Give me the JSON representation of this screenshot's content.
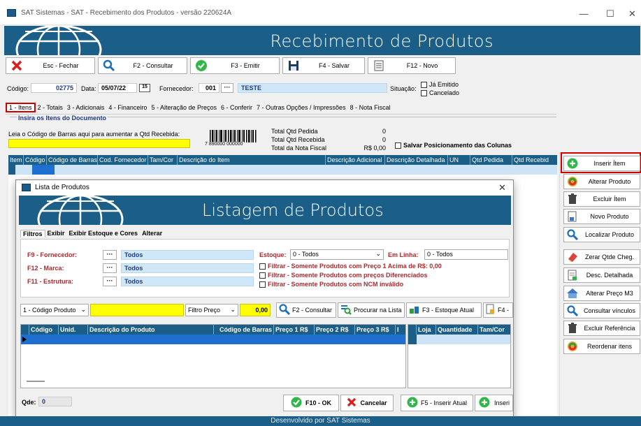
{
  "window": {
    "title": "SAT Sistemas - SAT - Recebimento dos Produtos - versão 220624A",
    "minimize": "—",
    "maximize": "☐",
    "close": "✕"
  },
  "banner": {
    "title": "Recebimento de Produtos"
  },
  "toolbar": [
    {
      "label": "Esc - Fechar",
      "icon": "close-icon"
    },
    {
      "label": "F2 - Consultar",
      "icon": "search-icon"
    },
    {
      "label": "F3 - Emitir",
      "icon": "check-icon"
    },
    {
      "label": "F4 - Salvar",
      "icon": "save-icon"
    },
    {
      "label": "F12 - Novo",
      "icon": "document-icon"
    }
  ],
  "header": {
    "codigo_label": "Código:",
    "codigo": "02775",
    "data_label": "Data:",
    "data": "05/07/22",
    "calendar": "15",
    "fornecedor_label": "Fornecedor:",
    "fornecedor_code": "001",
    "fornecedor_dots": "···",
    "fornecedor_name": "TESTE",
    "situacao_label": "Situação:",
    "ja_emitido": "Já Emitido",
    "cancelado": "Cancelado"
  },
  "tabs": [
    "1 - Itens",
    "2 - Totais",
    "3 - Adicionais",
    "4 - Financeiro",
    "5 - Alteração de Preços",
    "6 - Conferir",
    "7 - Outras Opções / Impressões",
    "8 - Nota Fiscal"
  ],
  "items": {
    "section_title": "Insira os Itens do Documento",
    "barcode_prompt": "Leia o Código de Barras aqui para aumentar a Qtd Recebida:",
    "barcode_number": "7 890000 000000",
    "totals": [
      {
        "label": "Total Qtd Pedida",
        "value": "0"
      },
      {
        "label": "Total Qtd Recebida",
        "value": "0"
      },
      {
        "label": "Total da Nota Fiscal",
        "value": "R$ 0,00"
      }
    ],
    "save_columns": "Salvar Posicionamento das Colunas",
    "columns": [
      "Item",
      "Código",
      "Código de Barras",
      "Cod. Fornecedor",
      "Tam/Cor",
      "Descrição do Item",
      "Descrição Adicional",
      "Descrição Detalhada",
      "UN",
      "Qtd Pedida",
      "Qtd Recebid"
    ]
  },
  "side_buttons": [
    {
      "label": "Inserir Ítem",
      "icon": "plus-circle-icon"
    },
    {
      "label": "Alterar Produto",
      "icon": "recycle-icon"
    },
    {
      "label": "Excluir Ítem",
      "icon": "trash-icon"
    },
    {
      "label": "Novo Produto",
      "icon": "new-product-icon"
    },
    {
      "label": "Localizar Produto",
      "icon": "search-icon"
    },
    {
      "label": "Zerar Qtde Cheg.",
      "icon": "eraser-icon"
    },
    {
      "label": "Desc. Detalhada",
      "icon": "document-edit-icon"
    },
    {
      "label": "Alterar Preço M3",
      "icon": "house-icon"
    },
    {
      "label": "Consultar vínculos",
      "icon": "search-icon"
    },
    {
      "label": "Excluir Referência",
      "icon": "trash-icon"
    },
    {
      "label": "Reordenar itens",
      "icon": "recycle-icon"
    }
  ],
  "modal": {
    "title": "Lista de Produtos",
    "close": "✕",
    "banner_title": "Listagem de Produtos",
    "tabs": [
      "Filtros",
      "Exibir",
      "Exibir Estoque e Cores",
      "Alterar"
    ],
    "filters": [
      {
        "label": "F9 - Fornecedor:",
        "value": "Todos"
      },
      {
        "label": "F12 - Marca:",
        "value": "Todos"
      },
      {
        "label": "F11 - Estrutura:",
        "value": "Todos"
      }
    ],
    "dots": "···",
    "estoque_label": "Estoque:",
    "estoque_value": "0 - Todos",
    "em_linha_label": "Em Linha:",
    "em_linha_value": "0 - Todos",
    "checks": [
      "Filtrar - Somente Produtos com Preço 1 Acima de R$: 0,00",
      "Filtrar - Somente Produtos com preços Diferenciados",
      "Filtrar - Somente Produtos com NCM inválido"
    ],
    "search_type": "1 - Código Produto",
    "price_filter": "Filtro Preço",
    "price_value": "0,00",
    "consultar": "F2 - Consultar",
    "procurar": "Procurar na Lista",
    "estoque_atual": "F3 - Estoque Atual",
    "f4": "F4 -",
    "columns": [
      "Código",
      "Unid.",
      "Descrição do Produto",
      "Código de Barras",
      "Preço 1 R$",
      "Preço 2 R$",
      "Preço 3 R$",
      "I"
    ],
    "side_columns": [
      "Loja",
      "Quantidade",
      "Tam/Cor"
    ],
    "qde_label": "Qde:",
    "qde_value": "0",
    "ok": "F10 - OK",
    "cancel": "Cancelar",
    "insert_current": "F5 - Inserir Atual",
    "insert": "Inseri"
  },
  "footer": "Desenvolvido por SAT Sistemas"
}
